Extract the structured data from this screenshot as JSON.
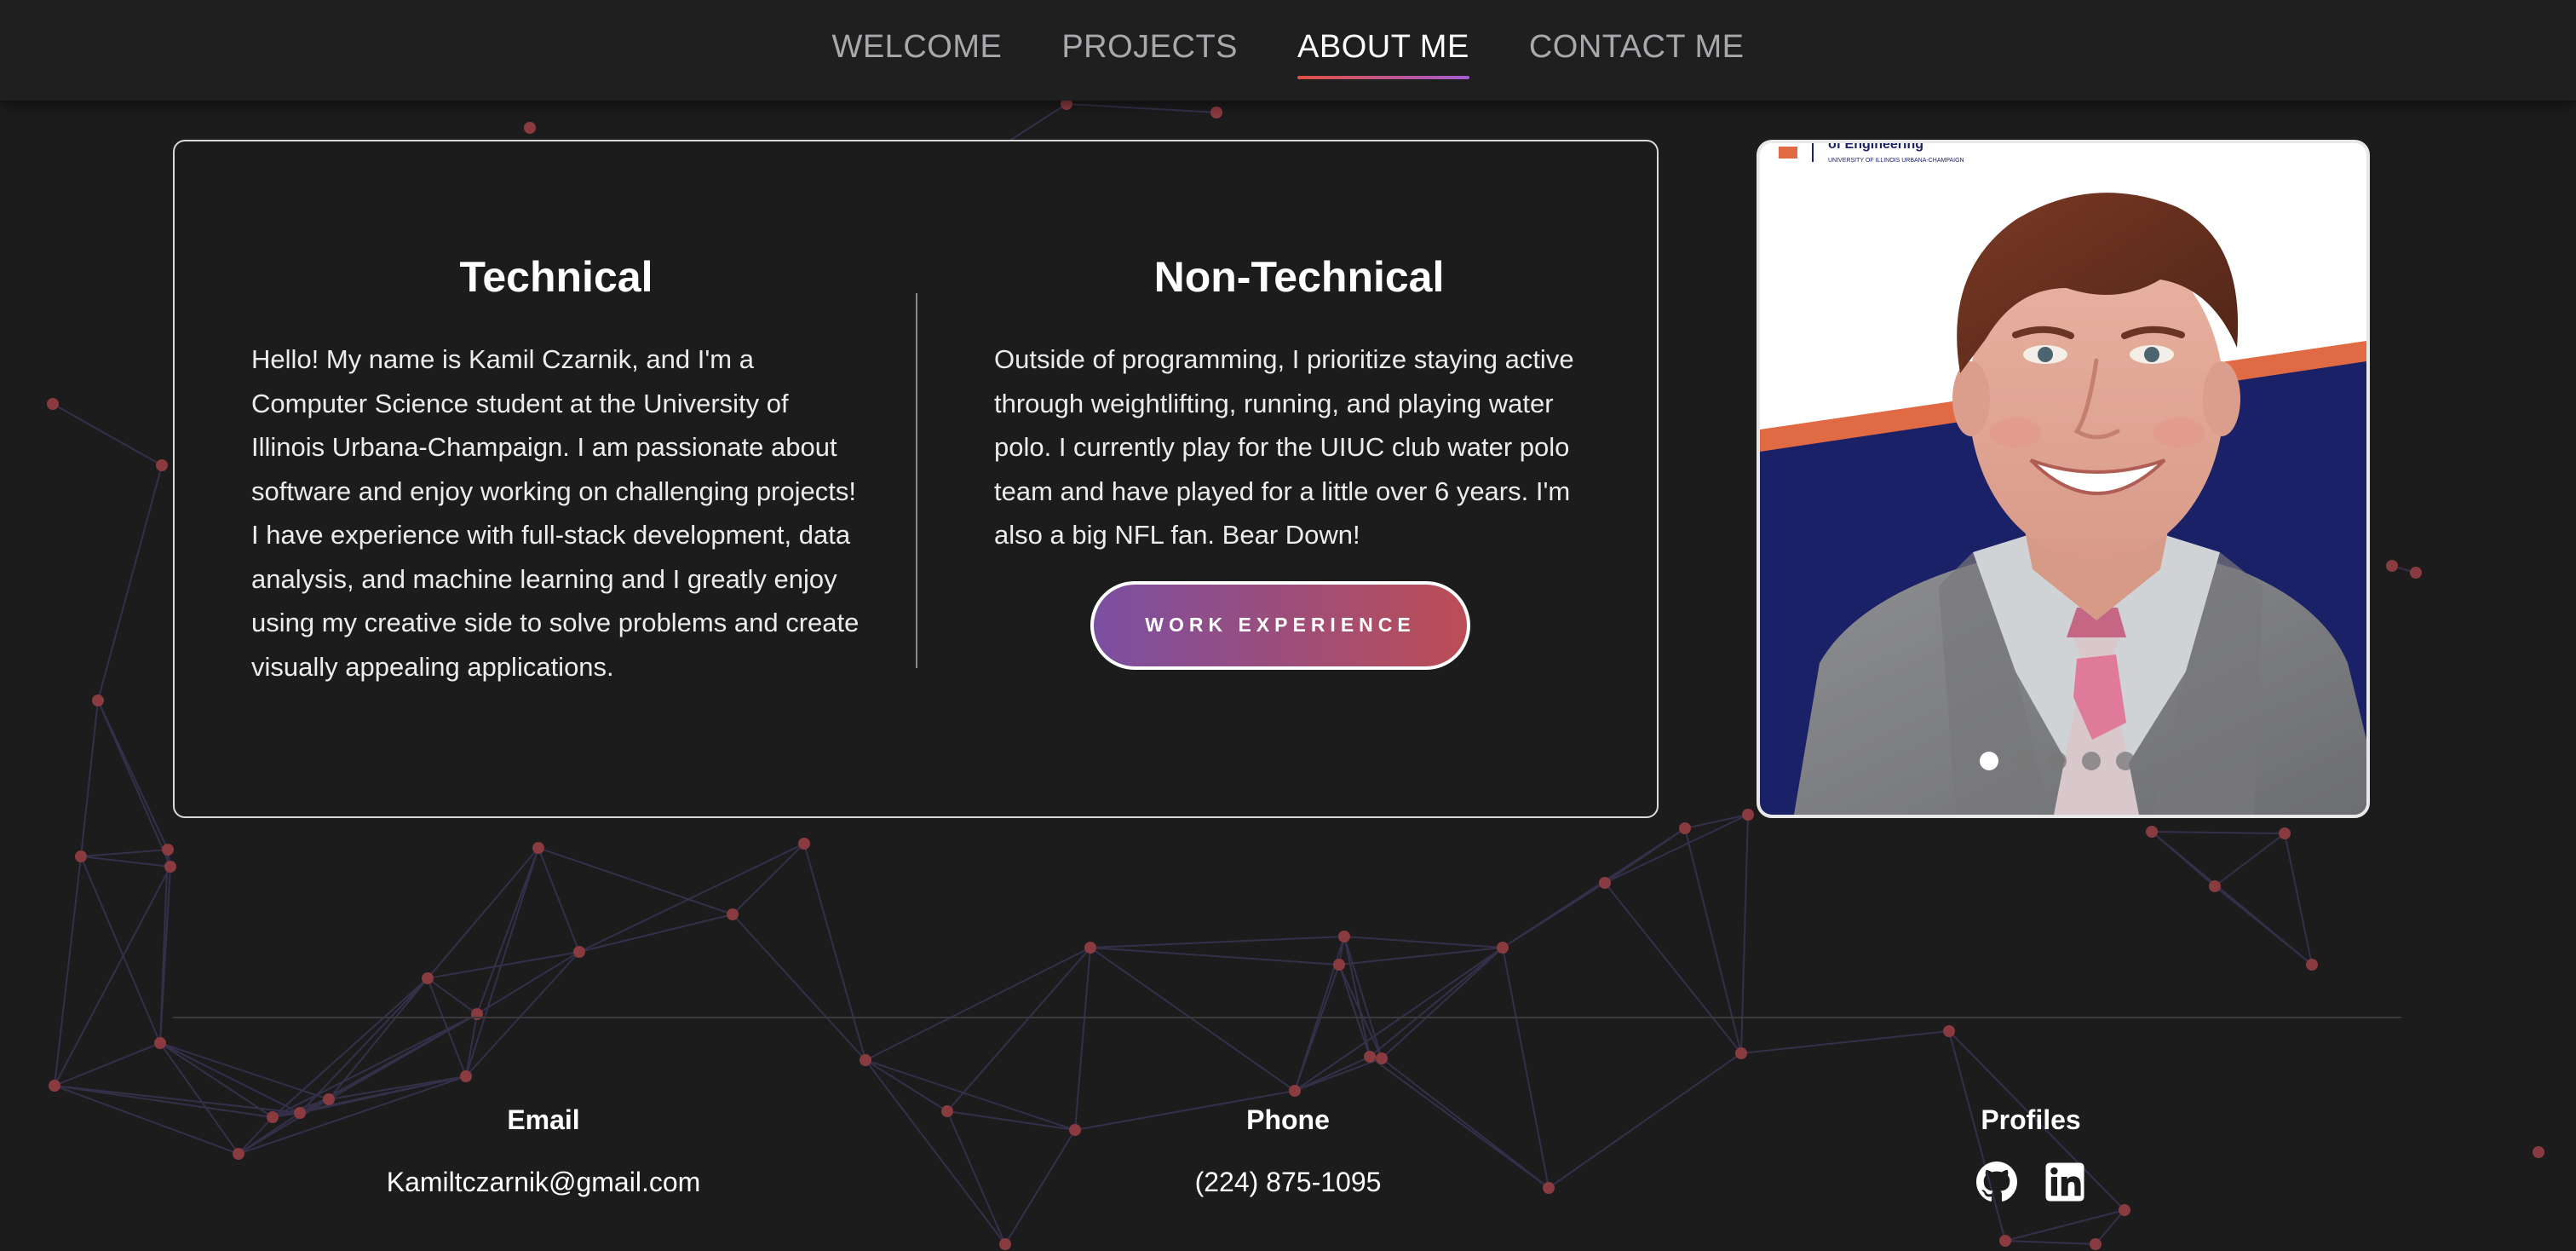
{
  "nav": {
    "items": [
      {
        "label": "WELCOME",
        "active": false
      },
      {
        "label": "PROJECTS",
        "active": false
      },
      {
        "label": "ABOUT ME",
        "active": true
      },
      {
        "label": "CONTACT ME",
        "active": false
      }
    ]
  },
  "about": {
    "technical": {
      "heading": "Technical",
      "body": "Hello! My name is Kamil Czarnik, and I'm a Computer Science student at the University of Illinois Urbana-Champaign. I am passionate about software and enjoy working on challenging projects! I have experience with full-stack development, data analysis, and machine learning and I greatly enjoy using my creative side to solve problems and create visually appealing applications."
    },
    "nontechnical": {
      "heading": "Non-Technical",
      "body": "Outside of programming, I prioritize staying active through weightlifting, running, and playing water polo. I currently play for the UIUC club water polo team and have played for a little over 6 years. I'm also a big NFL fan. Bear Down!",
      "button_label": "WORK EXPERIENCE"
    }
  },
  "photo": {
    "banner_text": "of Engineering",
    "banner_subtext": "UNIVERSITY OF ILLINOIS URBANA-CHAMPAIGN",
    "carousel": {
      "count": 5,
      "active_index": 0
    }
  },
  "footer": {
    "email": {
      "heading": "Email",
      "value": "Kamiltczarnik@gmail.com"
    },
    "phone": {
      "heading": "Phone",
      "value": "(224) 875-1095"
    },
    "profiles": {
      "heading": "Profiles",
      "icons": [
        "github-icon",
        "linkedin-icon"
      ]
    }
  },
  "colors": {
    "background": "#1c1c1d",
    "accent_gradient_start": "#7b4fa1",
    "accent_gradient_end": "#bc4d55",
    "nav_underline_start": "#e0503f",
    "nav_underline_end": "#a55bd3",
    "network_node": "#8a3b3f",
    "network_line": "#34304a"
  }
}
